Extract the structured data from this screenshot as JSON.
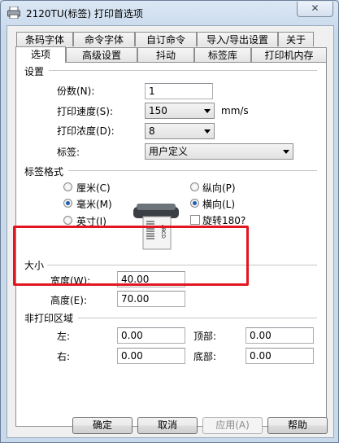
{
  "window": {
    "title": "2120TU(标签) 打印首选项",
    "close_glyph": "✕"
  },
  "tabs_row1": [
    "条码字体",
    "命令字体",
    "自订命令",
    "导入/导出设置",
    "关于"
  ],
  "tabs_row2": [
    "选项",
    "高级设置",
    "抖动",
    "标签库",
    "打印机内存"
  ],
  "active_tab": "选项",
  "settings": {
    "group_label": "设置",
    "copies_label": "份数(N):",
    "copies_key": "N",
    "copies_value": "1",
    "speed_label": "打印速度(S):",
    "speed_value": "150",
    "speed_unit": "mm/s",
    "darkness_label": "打印浓度(D):",
    "darkness_value": "8",
    "label_label": "标签:",
    "label_value": "用户定义"
  },
  "label_format": {
    "group_label": "标签格式",
    "unit_cm": "厘米(C)",
    "unit_mm": "毫米(M)",
    "unit_inch": "英寸(I)",
    "selected_unit": "mm",
    "orient_portrait": "纵向(P)",
    "orient_landscape": "横向(L)",
    "selected_orientation": "landscape",
    "rotate_180": "旋转180?",
    "rotate_checked": false,
    "preview_text": "ABCD"
  },
  "size": {
    "group_label": "大小",
    "width_label": "宽度(W):",
    "width_value": "40.00",
    "height_label": "高度(E):",
    "height_value": "70.00"
  },
  "unprintable": {
    "group_label": "非打印区域",
    "left_label": "左:",
    "left_value": "0.00",
    "top_label": "顶部:",
    "top_value": "0.00",
    "right_label": "右:",
    "right_value": "0.00",
    "bottom_label": "底部:",
    "bottom_value": "0.00"
  },
  "buttons": {
    "ok": "确定",
    "cancel": "取消",
    "apply": "应用(A)",
    "help": "帮助"
  },
  "colors": {
    "highlight_border": "#e2161f",
    "radio_dot": "#1d5fb3"
  }
}
